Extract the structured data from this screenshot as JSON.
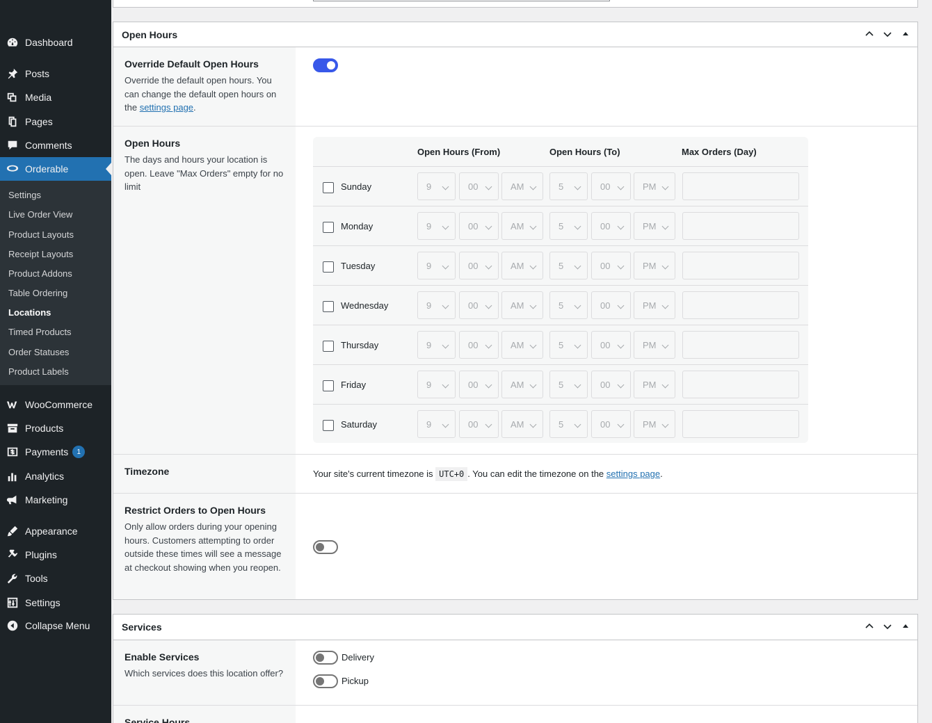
{
  "sidebar": {
    "top_items": [
      {
        "label": "Dashboard",
        "icon": "dashboard-icon"
      },
      {
        "label": "Posts",
        "icon": "pin-icon"
      },
      {
        "label": "Media",
        "icon": "media-icon"
      },
      {
        "label": "Pages",
        "icon": "pages-icon"
      },
      {
        "label": "Comments",
        "icon": "comment-icon"
      },
      {
        "label": "Orderable",
        "icon": "orderable-icon"
      }
    ],
    "submenu": [
      "Settings",
      "Live Order View",
      "Product Layouts",
      "Receipt Layouts",
      "Product Addons",
      "Table Ordering",
      "Locations",
      "Timed Products",
      "Order Statuses",
      "Product Labels"
    ],
    "bottom_items": [
      {
        "label": "WooCommerce",
        "icon": "woocommerce-icon"
      },
      {
        "label": "Products",
        "icon": "archive-icon"
      },
      {
        "label": "Payments",
        "icon": "payments-icon",
        "badge": "1"
      },
      {
        "label": "Analytics",
        "icon": "analytics-icon"
      },
      {
        "label": "Marketing",
        "icon": "megaphone-icon"
      },
      {
        "label": "Appearance",
        "icon": "brush-icon"
      },
      {
        "label": "Plugins",
        "icon": "plugin-icon"
      },
      {
        "label": "Tools",
        "icon": "wrench-icon"
      },
      {
        "label": "Settings",
        "icon": "settings-icon"
      },
      {
        "label": "Collapse Menu",
        "icon": "collapse-icon"
      }
    ]
  },
  "open_hours_panel": {
    "title": "Open Hours",
    "override": {
      "title": "Override Default Open Hours",
      "desc": "Override the default open hours. You can change the default open hours on the",
      "link": "settings page",
      "desc_end": ".",
      "enabled": true
    },
    "hours": {
      "title": "Open Hours",
      "desc": "The days and hours your location is open. Leave \"Max Orders\" empty for no limit",
      "col_from": "Open Hours (From)",
      "col_to": "Open Hours (To)",
      "col_max": "Max Orders (Day)",
      "days": [
        "Sunday",
        "Monday",
        "Tuesday",
        "Wednesday",
        "Thursday",
        "Friday",
        "Saturday"
      ],
      "from_hour": "9",
      "from_min": "00",
      "from_ampm": "AM",
      "to_hour": "5",
      "to_min": "00",
      "to_ampm": "PM"
    },
    "timezone": {
      "title": "Timezone",
      "text_before": "Your site's current timezone is",
      "value": "UTC+0",
      "text_after": ". You can edit the timezone on the",
      "link": "settings page",
      "text_end": "."
    },
    "restrict": {
      "title": "Restrict Orders to Open Hours",
      "desc": "Only allow orders during your opening hours. Customers attempting to order outside these times will see a message at checkout showing when you reopen.",
      "enabled": false
    }
  },
  "services_panel": {
    "title": "Services",
    "enable": {
      "title": "Enable Services",
      "desc": "Which services does this location offer?",
      "delivery": "Delivery",
      "pickup": "Pickup"
    },
    "next_row_title": "Service Hours"
  }
}
